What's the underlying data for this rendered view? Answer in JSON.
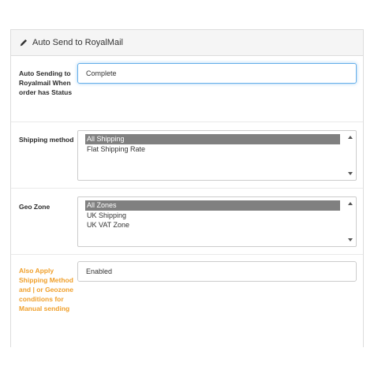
{
  "panel": {
    "title": "Auto Send to RoyalMail",
    "icon": "pencil-icon"
  },
  "fields": {
    "auto_status": {
      "label": "Auto Sending to Royalmail When order has Status",
      "value": "Complete"
    },
    "shipping_method": {
      "label": "Shipping method",
      "options": [
        "All Shipping",
        "Flat Shipping Rate"
      ],
      "selected": "All Shipping"
    },
    "geo_zone": {
      "label": "Geo Zone",
      "options": [
        "All Zones",
        "UK Shipping",
        "UK VAT Zone"
      ],
      "selected": "All Zones"
    },
    "also_apply": {
      "label": "Also Apply Shipping Method and | or Geozone conditions for Manual sending",
      "value": "Enabled"
    }
  },
  "colors": {
    "label_accent": "#f0a02c",
    "selected_option_bg": "#808080",
    "focus_border": "#66afe9"
  }
}
